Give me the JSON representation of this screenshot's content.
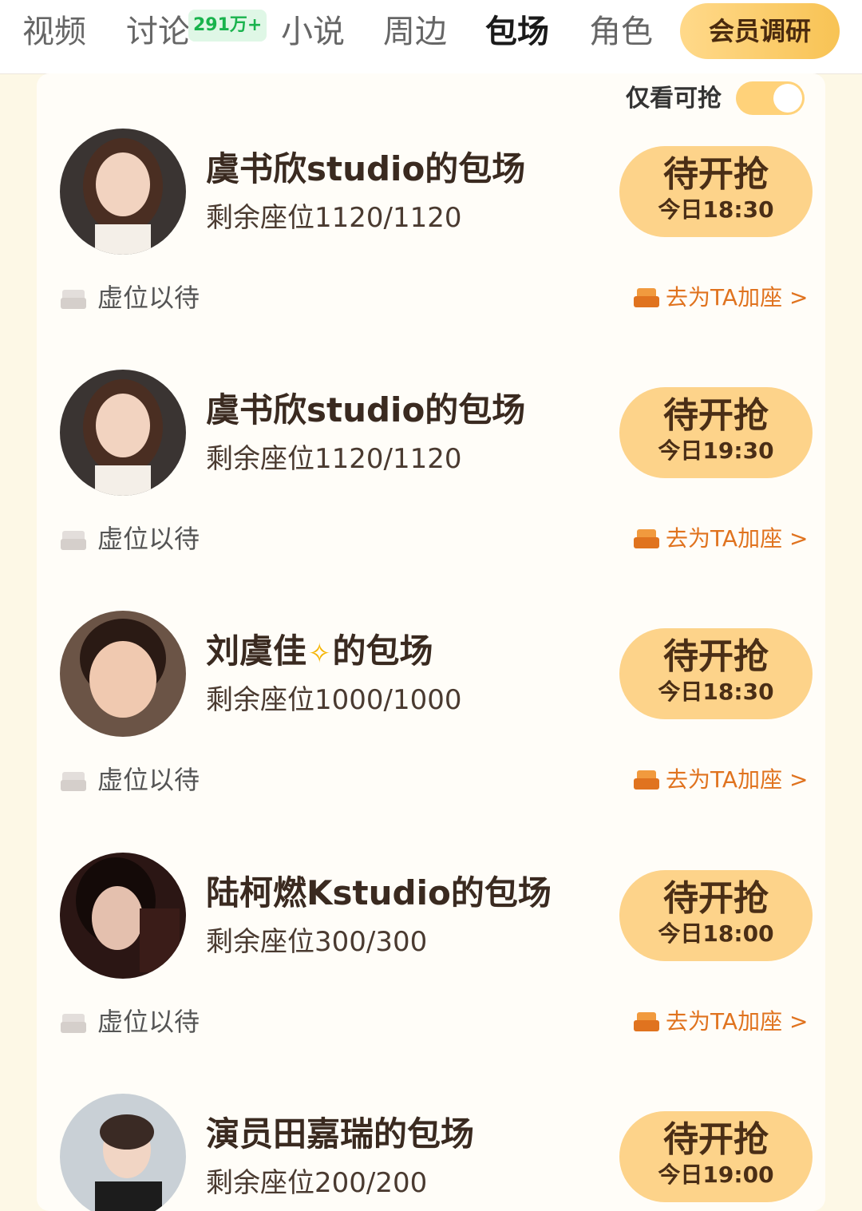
{
  "tabs": {
    "video": "视频",
    "discuss": "讨论",
    "discuss_badge": "291万+",
    "novel": "小说",
    "merch": "周边",
    "screening": "包场",
    "role": "角色",
    "member_survey": "会员调研"
  },
  "filter": {
    "label": "仅看可抢",
    "enabled": true
  },
  "cards": [
    {
      "title": "虞书欣studio的包场",
      "seats": "剩余座位1120/1120",
      "status": "待开抢",
      "time": "今日18:30",
      "wait": "虚位以待",
      "add": "去为TA加座 >"
    },
    {
      "title": "虞书欣studio的包场",
      "seats": "剩余座位1120/1120",
      "status": "待开抢",
      "time": "今日19:30",
      "wait": "虚位以待",
      "add": "去为TA加座 >"
    },
    {
      "title_pre": "刘虞佳",
      "title_post": "的包场",
      "seats": "剩余座位1000/1000",
      "status": "待开抢",
      "time": "今日18:30",
      "wait": "虚位以待",
      "add": "去为TA加座 >"
    },
    {
      "title": "陆柯燃Kstudio的包场",
      "seats": "剩余座位300/300",
      "status": "待开抢",
      "time": "今日18:00",
      "wait": "虚位以待",
      "add": "去为TA加座 >"
    },
    {
      "title": "演员田嘉瑞的包场",
      "seats": "剩余座位200/200",
      "status": "待开抢",
      "time": "今日19:00"
    }
  ],
  "colors": {
    "accent": "#fdd38a",
    "orange": "#e0731f",
    "badge_green": "#19b34d"
  }
}
